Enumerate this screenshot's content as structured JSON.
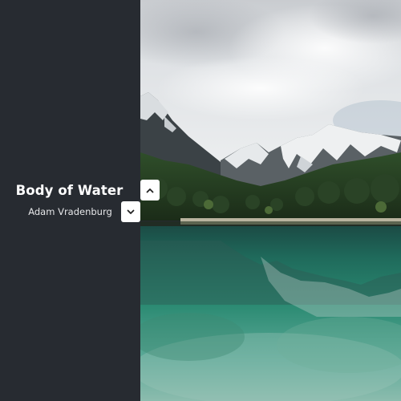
{
  "slide": {
    "title": "Body of Water",
    "author": "Adam Vradenburg"
  },
  "controls": {
    "up_icon": "chevron-up-icon",
    "down_icon": "chevron-down-icon"
  },
  "colors": {
    "sidebar_bg": "#272b31",
    "button_bg": "#ffffff",
    "title_text": "#ffffff"
  }
}
